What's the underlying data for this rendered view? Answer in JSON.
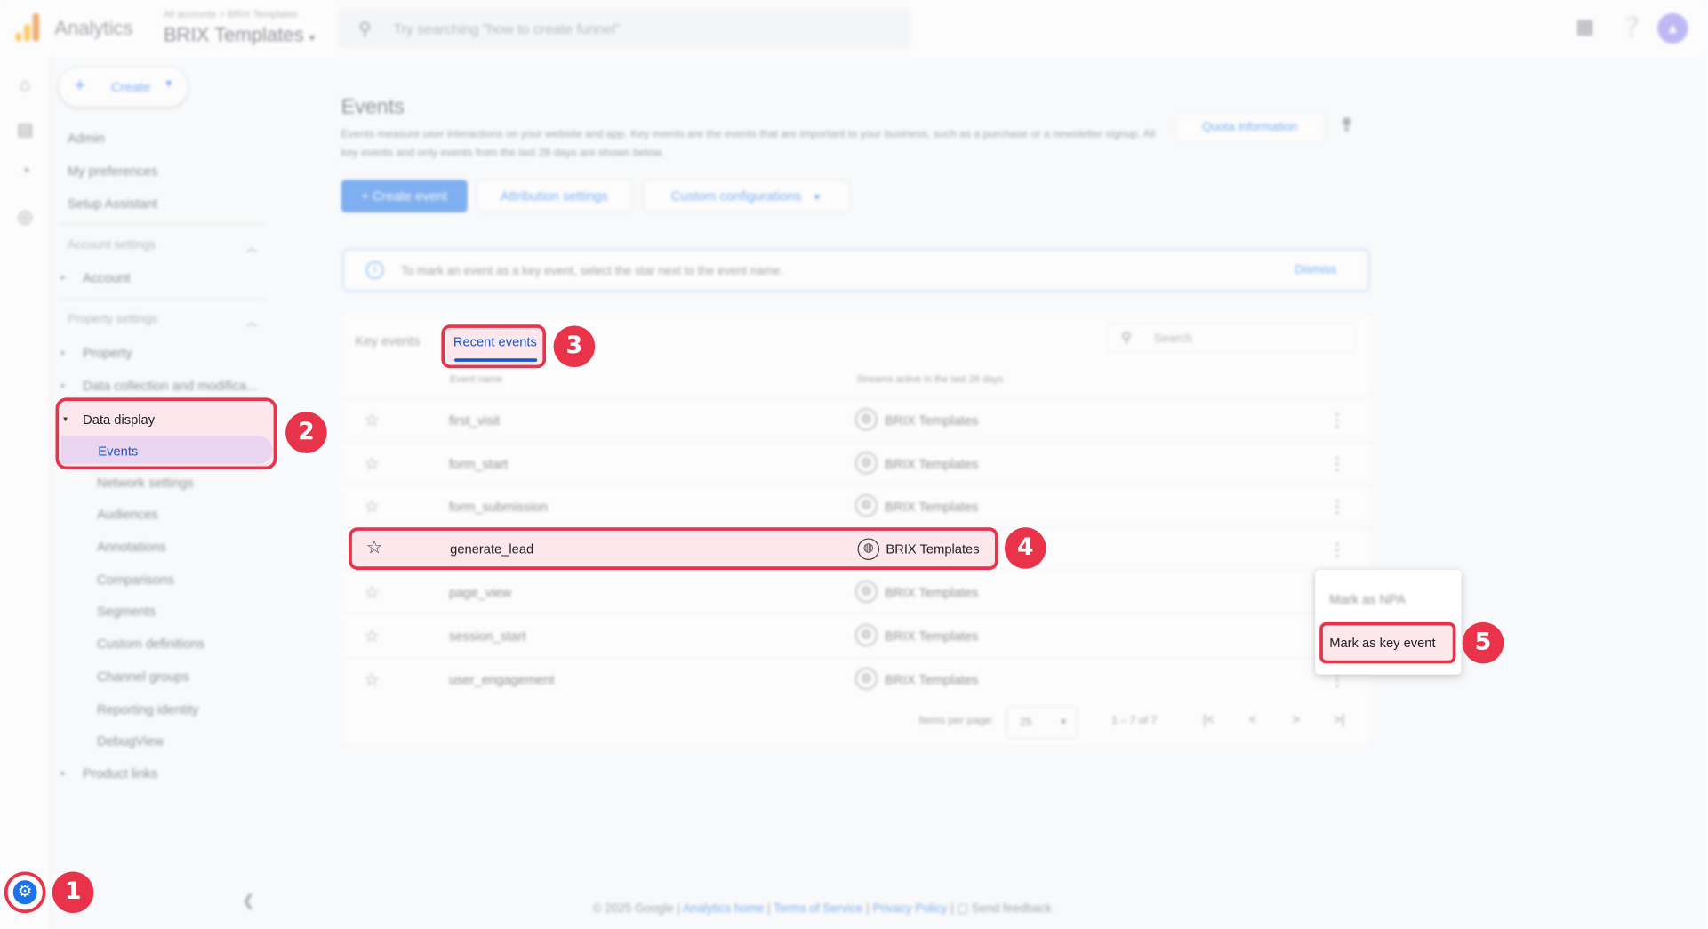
{
  "topbar": {
    "app_name": "Analytics",
    "breadcrumb_small": "All accounts > BRIX Templates",
    "property_name": "BRIX Templates",
    "search_placeholder": "Try searching \"how to create funnel\""
  },
  "sidebar": {
    "create_label": "Create",
    "top_items": [
      "Admin",
      "My preferences",
      "Setup Assistant"
    ],
    "account_section": "Account settings",
    "account_item": "Account",
    "property_section": "Property settings",
    "property_item": "Property",
    "data_collection_item": "Data collection and modifica...",
    "data_display_item": "Data display",
    "events_item": "Events",
    "sub_items": [
      "Network settings",
      "Audiences",
      "Annotations",
      "Comparisons",
      "Segments",
      "Custom definitions",
      "Channel groups",
      "Reporting identity",
      "DebugView"
    ],
    "product_links_item": "Product links"
  },
  "main": {
    "title": "Events",
    "description": "Events measure user interactions on your website and app. Key events are the events that are important to your business, such as a purchase or a newsletter signup. All key events and only events from the last 28 days are shown below.",
    "quota_button": "Quota information",
    "create_event_button": "Create event",
    "attribution_button": "Attribution settings",
    "custom_config_button": "Custom configurations",
    "info_text": "To mark an event as a key event, select the star next to the event name.",
    "dismiss_label": "Dismiss",
    "tab_key_events": "Key events",
    "tab_recent_events": "Recent events",
    "search_placeholder": "Search",
    "col_event_name": "Event name",
    "col_streams": "Streams active in the last 28 days",
    "rows": [
      {
        "name": "first_visit",
        "stream": "BRIX Templates"
      },
      {
        "name": "form_start",
        "stream": "BRIX Templates"
      },
      {
        "name": "form_submission",
        "stream": "BRIX Templates"
      },
      {
        "name": "generate_lead",
        "stream": "BRIX Templates"
      },
      {
        "name": "page_view",
        "stream": "BRIX Templates"
      },
      {
        "name": "session_start",
        "stream": "BRIX Templates"
      },
      {
        "name": "user_engagement",
        "stream": "BRIX Templates"
      }
    ],
    "items_per_page_label": "Items per page:",
    "items_per_page_value": "25",
    "page_range": "1 – 7 of 7"
  },
  "context_menu": {
    "mark_npa": "Mark as NPA",
    "mark_key_event": "Mark as key event"
  },
  "footer": {
    "copyright": "© 2025 Google |",
    "analytics_home": "Analytics home",
    "terms": "Terms of Service",
    "privacy": "Privacy Policy",
    "feedback": "Send feedback",
    "sep": "|"
  },
  "steps": [
    "1",
    "2",
    "3",
    "4",
    "5"
  ],
  "colors": {
    "highlight": "#e8334a",
    "accent": "#1a73e8"
  }
}
